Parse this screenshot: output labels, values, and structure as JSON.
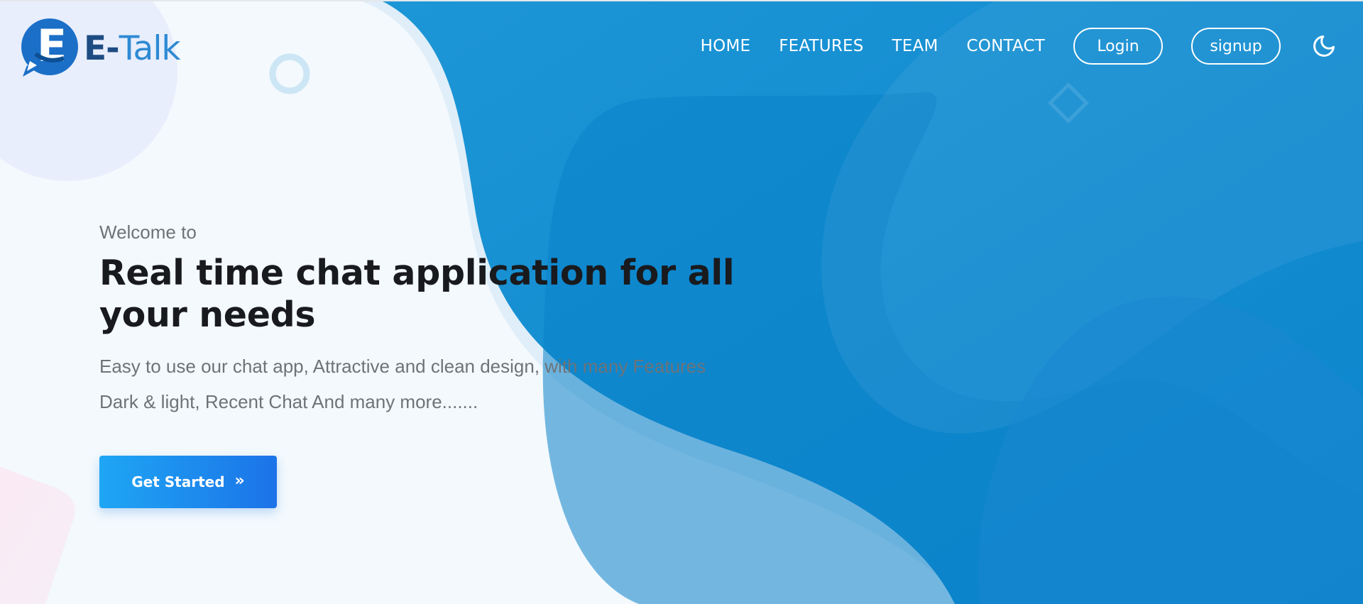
{
  "brand": {
    "logo_letter": "E",
    "name_prefix": "-",
    "name_main": "Talk"
  },
  "nav": {
    "links": [
      "HOME",
      "FEATURES",
      "TEAM",
      "CONTACT"
    ],
    "login_label": "Login",
    "signup_label": "signup",
    "theme_toggle_icon": "moon-icon"
  },
  "hero": {
    "eyebrow": "Welcome to",
    "headline": "Real time chat application for all your needs",
    "description_lines": [
      "Easy to use our chat app, Attractive and clean design, with many Features",
      "Dark & light, Recent Chat And many more......."
    ],
    "cta_label": "Get Started",
    "cta_icon": "double-chevron-right-icon"
  },
  "colors": {
    "primary_blue": "#1b8fd1",
    "deep_blue": "#0a7ec9",
    "cta_start": "#1ea6f4",
    "cta_end": "#1c73e8",
    "logo_dark": "#1e4c83",
    "logo_light": "#2e8ad3",
    "headline": "#191a1e",
    "body_text": "#6e7378",
    "page_background": "#f3f9fd"
  }
}
